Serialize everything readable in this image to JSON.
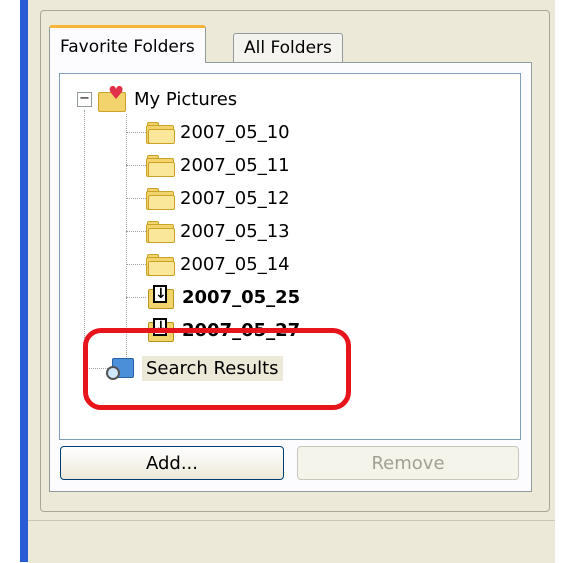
{
  "tabs": [
    {
      "label": "Favorite Folders",
      "active": true
    },
    {
      "label": "All Folders",
      "active": false
    }
  ],
  "tree": {
    "root": {
      "label": "My Pictures",
      "expander": "⊟",
      "icon": "my-pictures-icon"
    },
    "folders": [
      {
        "label": "2007_05_10",
        "icon": "folder-icon",
        "bold": false
      },
      {
        "label": "2007_05_11",
        "icon": "folder-icon",
        "bold": false
      },
      {
        "label": "2007_05_12",
        "icon": "folder-icon",
        "bold": false
      },
      {
        "label": "2007_05_13",
        "icon": "folder-icon",
        "bold": false
      },
      {
        "label": "2007_05_14",
        "icon": "folder-icon",
        "bold": false
      },
      {
        "label": "2007_05_25",
        "icon": "sync-folder-icon",
        "bold": true
      },
      {
        "label": "2007_05_27",
        "icon": "sync-folder-icon",
        "bold": true
      }
    ],
    "search": {
      "label": "Search Results",
      "icon": "search-results-icon"
    }
  },
  "buttons": {
    "add_label": "Add...",
    "remove_label": "Remove"
  },
  "annotation": {
    "color": "#e8141c"
  }
}
